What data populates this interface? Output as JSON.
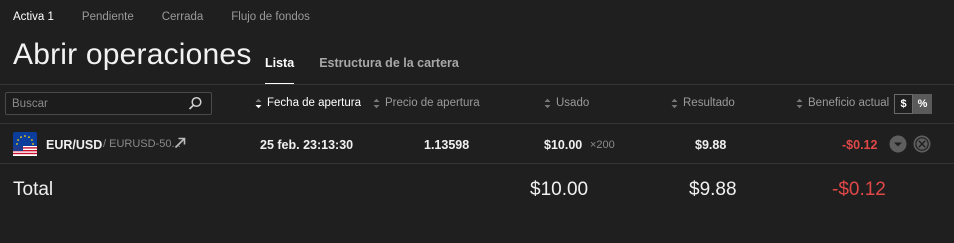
{
  "top_tabs": [
    {
      "label": "Activa 1",
      "active": true
    },
    {
      "label": "Pendiente",
      "active": false
    },
    {
      "label": "Cerrada",
      "active": false
    },
    {
      "label": "Flujo de fondos",
      "active": false
    }
  ],
  "page_title": "Abrir operaciones",
  "view_tabs": [
    {
      "label": "Lista",
      "active": true
    },
    {
      "label": "Estructura de la cartera",
      "active": false
    }
  ],
  "search": {
    "placeholder": "Buscar",
    "value": ""
  },
  "columns": {
    "open_date": "Fecha de apertura",
    "open_price": "Precio de apertura",
    "used": "Usado",
    "result": "Resultado",
    "current_profit": "Beneficio actual"
  },
  "display_toggle": {
    "dollar": "$",
    "percent": "%"
  },
  "positions": [
    {
      "pair": "EUR/USD",
      "instrument": "/ EURUSD-50...",
      "open_date": "25 feb. 23:13:30",
      "open_price": "1.13598",
      "used": "$10.00",
      "multiplier": "×200",
      "result": "$9.88",
      "current_profit": "-$0.12"
    }
  ],
  "totals": {
    "label": "Total",
    "used": "$10.00",
    "result": "$9.88",
    "current_profit": "-$0.12"
  },
  "colors": {
    "background": "#1f1f1f",
    "negative": "#e04848",
    "text_primary": "#ffffff",
    "text_muted": "#9a9a9a"
  },
  "icons": [
    "search-icon",
    "sort-desc-icon",
    "sort-icon",
    "eu-us-flag-icon",
    "external-link-icon",
    "chevron-down-icon",
    "close-icon"
  ]
}
